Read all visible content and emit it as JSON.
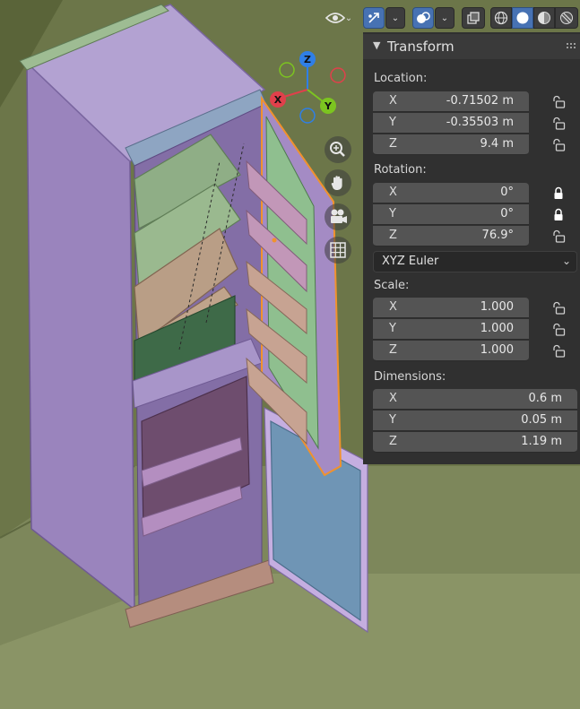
{
  "header": {
    "buttons": [
      {
        "name": "visibility-dropdown",
        "icon": "eye-icon"
      },
      {
        "name": "gizmo-toggle",
        "icon": "gizmo-arrow-icon",
        "active": true
      },
      {
        "name": "overlays-toggle",
        "icon": "overlay-circles-icon",
        "active": true
      },
      {
        "name": "xray-toggle",
        "icon": "xray-icon"
      },
      {
        "name": "shading-wireframe",
        "icon": "wireframe-sphere-icon"
      },
      {
        "name": "shading-solid",
        "icon": "solid-sphere-icon",
        "active": true
      },
      {
        "name": "shading-material",
        "icon": "material-sphere-icon"
      },
      {
        "name": "shading-rendered",
        "icon": "rendered-sphere-icon"
      }
    ],
    "dropdown_glyph": "⌄"
  },
  "gizmo": {
    "axes": {
      "x": "X",
      "y": "Y",
      "z": "Z"
    },
    "colors": {
      "x": "#e0404b",
      "y": "#7cc420",
      "z": "#2f7fe6"
    }
  },
  "nav_tools": [
    "zoom-icon",
    "hand-pan-icon",
    "camera-icon",
    "grid-ortho-icon"
  ],
  "panel": {
    "title": "Transform",
    "location": {
      "label": "Location:",
      "rows": [
        {
          "axis": "X",
          "value": "-0.71502 m",
          "locked": false
        },
        {
          "axis": "Y",
          "value": "-0.35503 m",
          "locked": false
        },
        {
          "axis": "Z",
          "value": "9.4 m",
          "locked": false
        }
      ]
    },
    "rotation": {
      "label": "Rotation:",
      "rows": [
        {
          "axis": "X",
          "value": "0°",
          "locked": true
        },
        {
          "axis": "Y",
          "value": "0°",
          "locked": true
        },
        {
          "axis": "Z",
          "value": "76.9°",
          "locked": false
        }
      ],
      "mode": "XYZ Euler"
    },
    "scale": {
      "label": "Scale:",
      "rows": [
        {
          "axis": "X",
          "value": "1.000",
          "locked": false
        },
        {
          "axis": "Y",
          "value": "1.000",
          "locked": false
        },
        {
          "axis": "Z",
          "value": "1.000",
          "locked": false
        }
      ]
    },
    "dimensions": {
      "label": "Dimensions:",
      "rows": [
        {
          "axis": "X",
          "value": "0.6 m"
        },
        {
          "axis": "Y",
          "value": "0.05 m"
        },
        {
          "axis": "Z",
          "value": "1.19 m"
        }
      ]
    }
  },
  "colors": {
    "panel_bg": "#303030",
    "field_bg": "#545454",
    "accent": "#4772b3",
    "selection": "#f0922d",
    "fridge_body": "#9b86bf",
    "shelf_green": "#8fae86",
    "shelf_tan": "#b79c85",
    "floor": "#7a8459"
  }
}
